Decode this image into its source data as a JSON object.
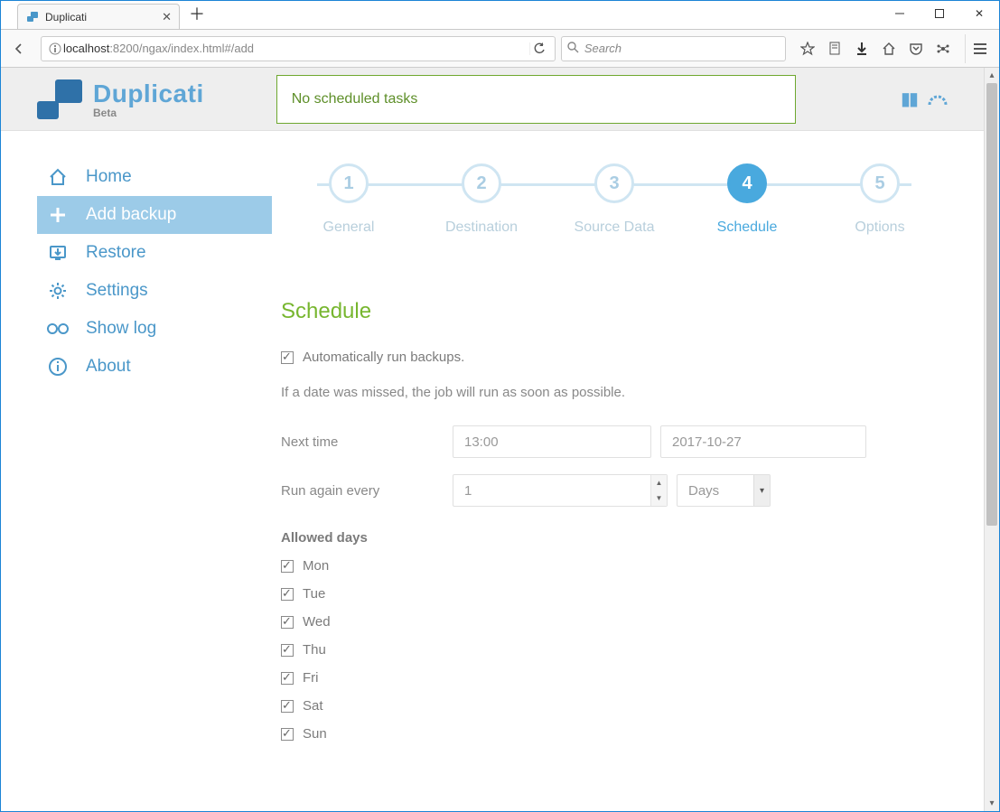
{
  "window": {
    "tab_title": "Duplicati"
  },
  "browser": {
    "url_host": "localhost",
    "url_rest": ":8200/ngax/index.html#/add",
    "search_placeholder": "Search"
  },
  "app": {
    "name": "Duplicati",
    "edition": "Beta",
    "status_message": "No scheduled tasks"
  },
  "sidebar": {
    "items": [
      {
        "label": "Home"
      },
      {
        "label": "Add backup"
      },
      {
        "label": "Restore"
      },
      {
        "label": "Settings"
      },
      {
        "label": "Show log"
      },
      {
        "label": "About"
      }
    ]
  },
  "wizard": {
    "steps": [
      {
        "num": "1",
        "label": "General"
      },
      {
        "num": "2",
        "label": "Destination"
      },
      {
        "num": "3",
        "label": "Source Data"
      },
      {
        "num": "4",
        "label": "Schedule"
      },
      {
        "num": "5",
        "label": "Options"
      }
    ],
    "active_index": 3
  },
  "schedule": {
    "section_title": "Schedule",
    "auto_label": "Automatically run backups.",
    "auto_checked": true,
    "note": "If a date was missed, the job will run as soon as possible.",
    "next_time_label": "Next time",
    "next_time_value": "13:00",
    "next_date_value": "2017-10-27",
    "run_again_label": "Run again every",
    "run_again_value": "1",
    "run_again_unit": "Days",
    "allowed_days_label": "Allowed days",
    "days": [
      {
        "label": "Mon",
        "checked": true
      },
      {
        "label": "Tue",
        "checked": true
      },
      {
        "label": "Wed",
        "checked": true
      },
      {
        "label": "Thu",
        "checked": true
      },
      {
        "label": "Fri",
        "checked": true
      },
      {
        "label": "Sat",
        "checked": true
      },
      {
        "label": "Sun",
        "checked": true
      }
    ]
  }
}
